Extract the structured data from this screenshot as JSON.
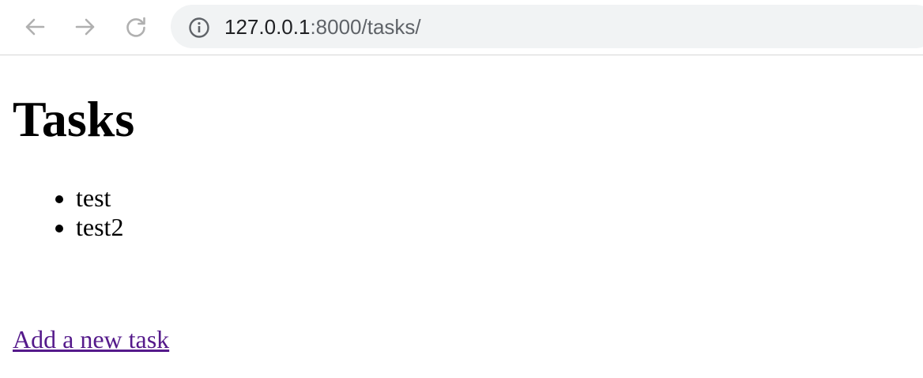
{
  "browser": {
    "nav": {
      "back_icon": "arrow-left-icon",
      "forward_icon": "arrow-right-icon",
      "reload_icon": "reload-icon"
    },
    "address_bar": {
      "icon": "info-icon",
      "host": "127.0.0.1",
      "path": ":8000/tasks/"
    }
  },
  "page": {
    "title": "Tasks",
    "tasks": [
      {
        "label": "test"
      },
      {
        "label": "test2"
      }
    ],
    "add_link_label": "Add a new task"
  },
  "colors": {
    "nav_icon": "#b0b0b0",
    "omnibox_bg": "#f1f3f4",
    "link_visited": "#551a8b"
  }
}
